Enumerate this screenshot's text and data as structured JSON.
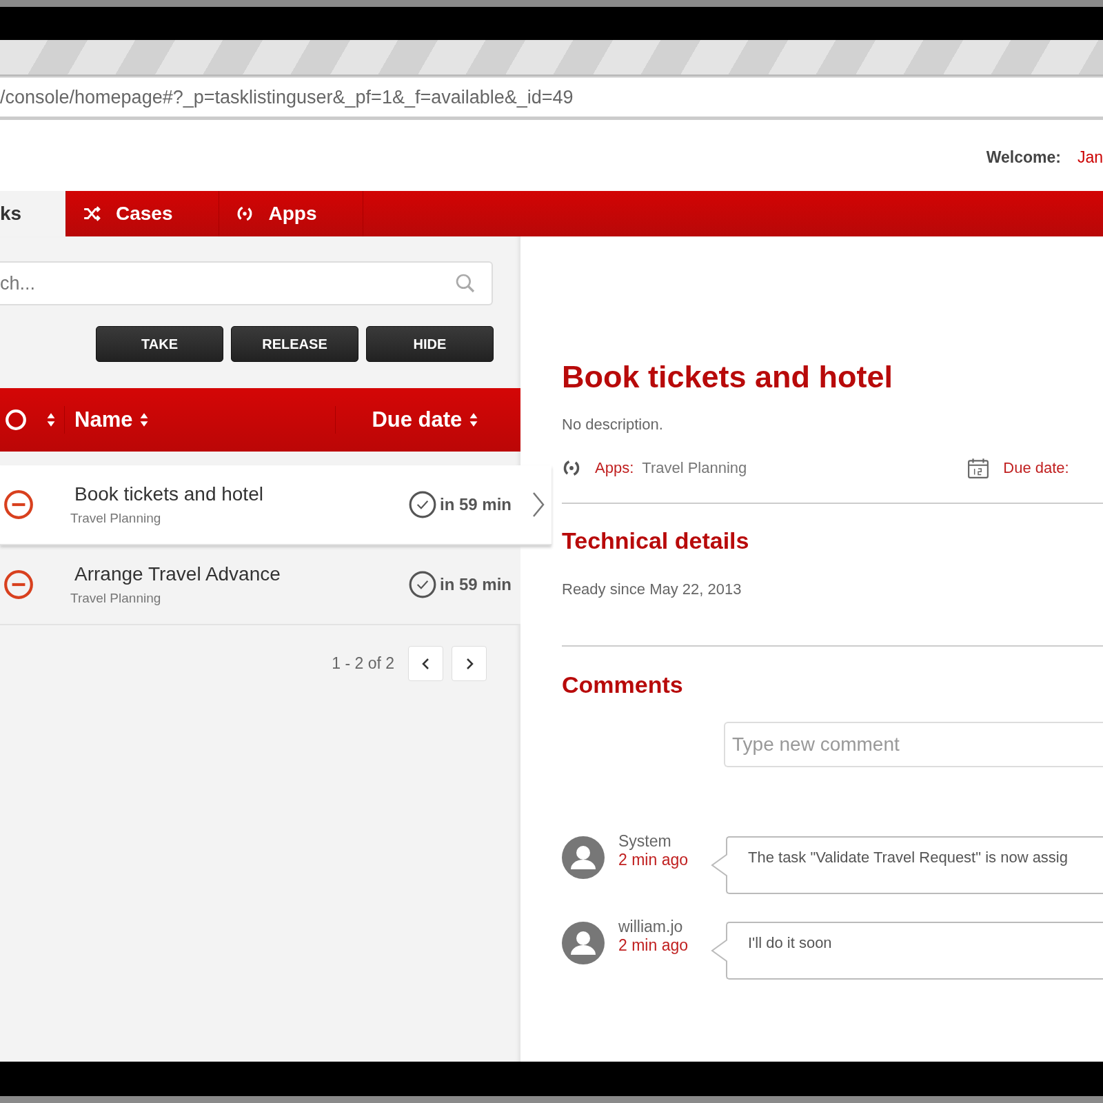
{
  "browser": {
    "url": "/console/homepage#?_p=tasklistinguser&_pf=1&_f=available&_id=49"
  },
  "header": {
    "welcome_label": "Welcome:",
    "user": "Jan"
  },
  "nav": [
    {
      "label": "ks",
      "kind": "plain",
      "selected": true
    },
    {
      "label": "Cases",
      "kind": "shuffle",
      "selected": false
    },
    {
      "label": "Apps",
      "kind": "apps",
      "selected": false
    }
  ],
  "search": {
    "placeholder": "ch..."
  },
  "actions": [
    "TAKE",
    "RELEASE",
    "HIDE"
  ],
  "table": {
    "columns": [
      "Name",
      "Due date"
    ],
    "rows": [
      {
        "name": "Book tickets and hotel",
        "app": "Travel Planning",
        "due": "in 59 min",
        "selected": true
      },
      {
        "name": "Arrange Travel Advance",
        "app": "Travel Planning",
        "due": "in 59 min",
        "selected": false
      }
    ]
  },
  "pagination": {
    "range": "1 - 2 of 2"
  },
  "detail": {
    "title": "Book tickets and hotel",
    "description": "No description.",
    "apps_label": "Apps:",
    "apps_value": "Travel Planning",
    "due_label": "Due date:",
    "technical_title": "Technical details",
    "ready": "Ready since May 22, 2013",
    "comments_title": "Comments",
    "comment_placeholder": "Type new comment",
    "comments": [
      {
        "author": "System",
        "time": "2 min ago",
        "text": "The task \"Validate Travel Request\" is now assig"
      },
      {
        "author": "william.jo",
        "time": "2 min ago",
        "text": "I'll do it soon"
      }
    ]
  }
}
